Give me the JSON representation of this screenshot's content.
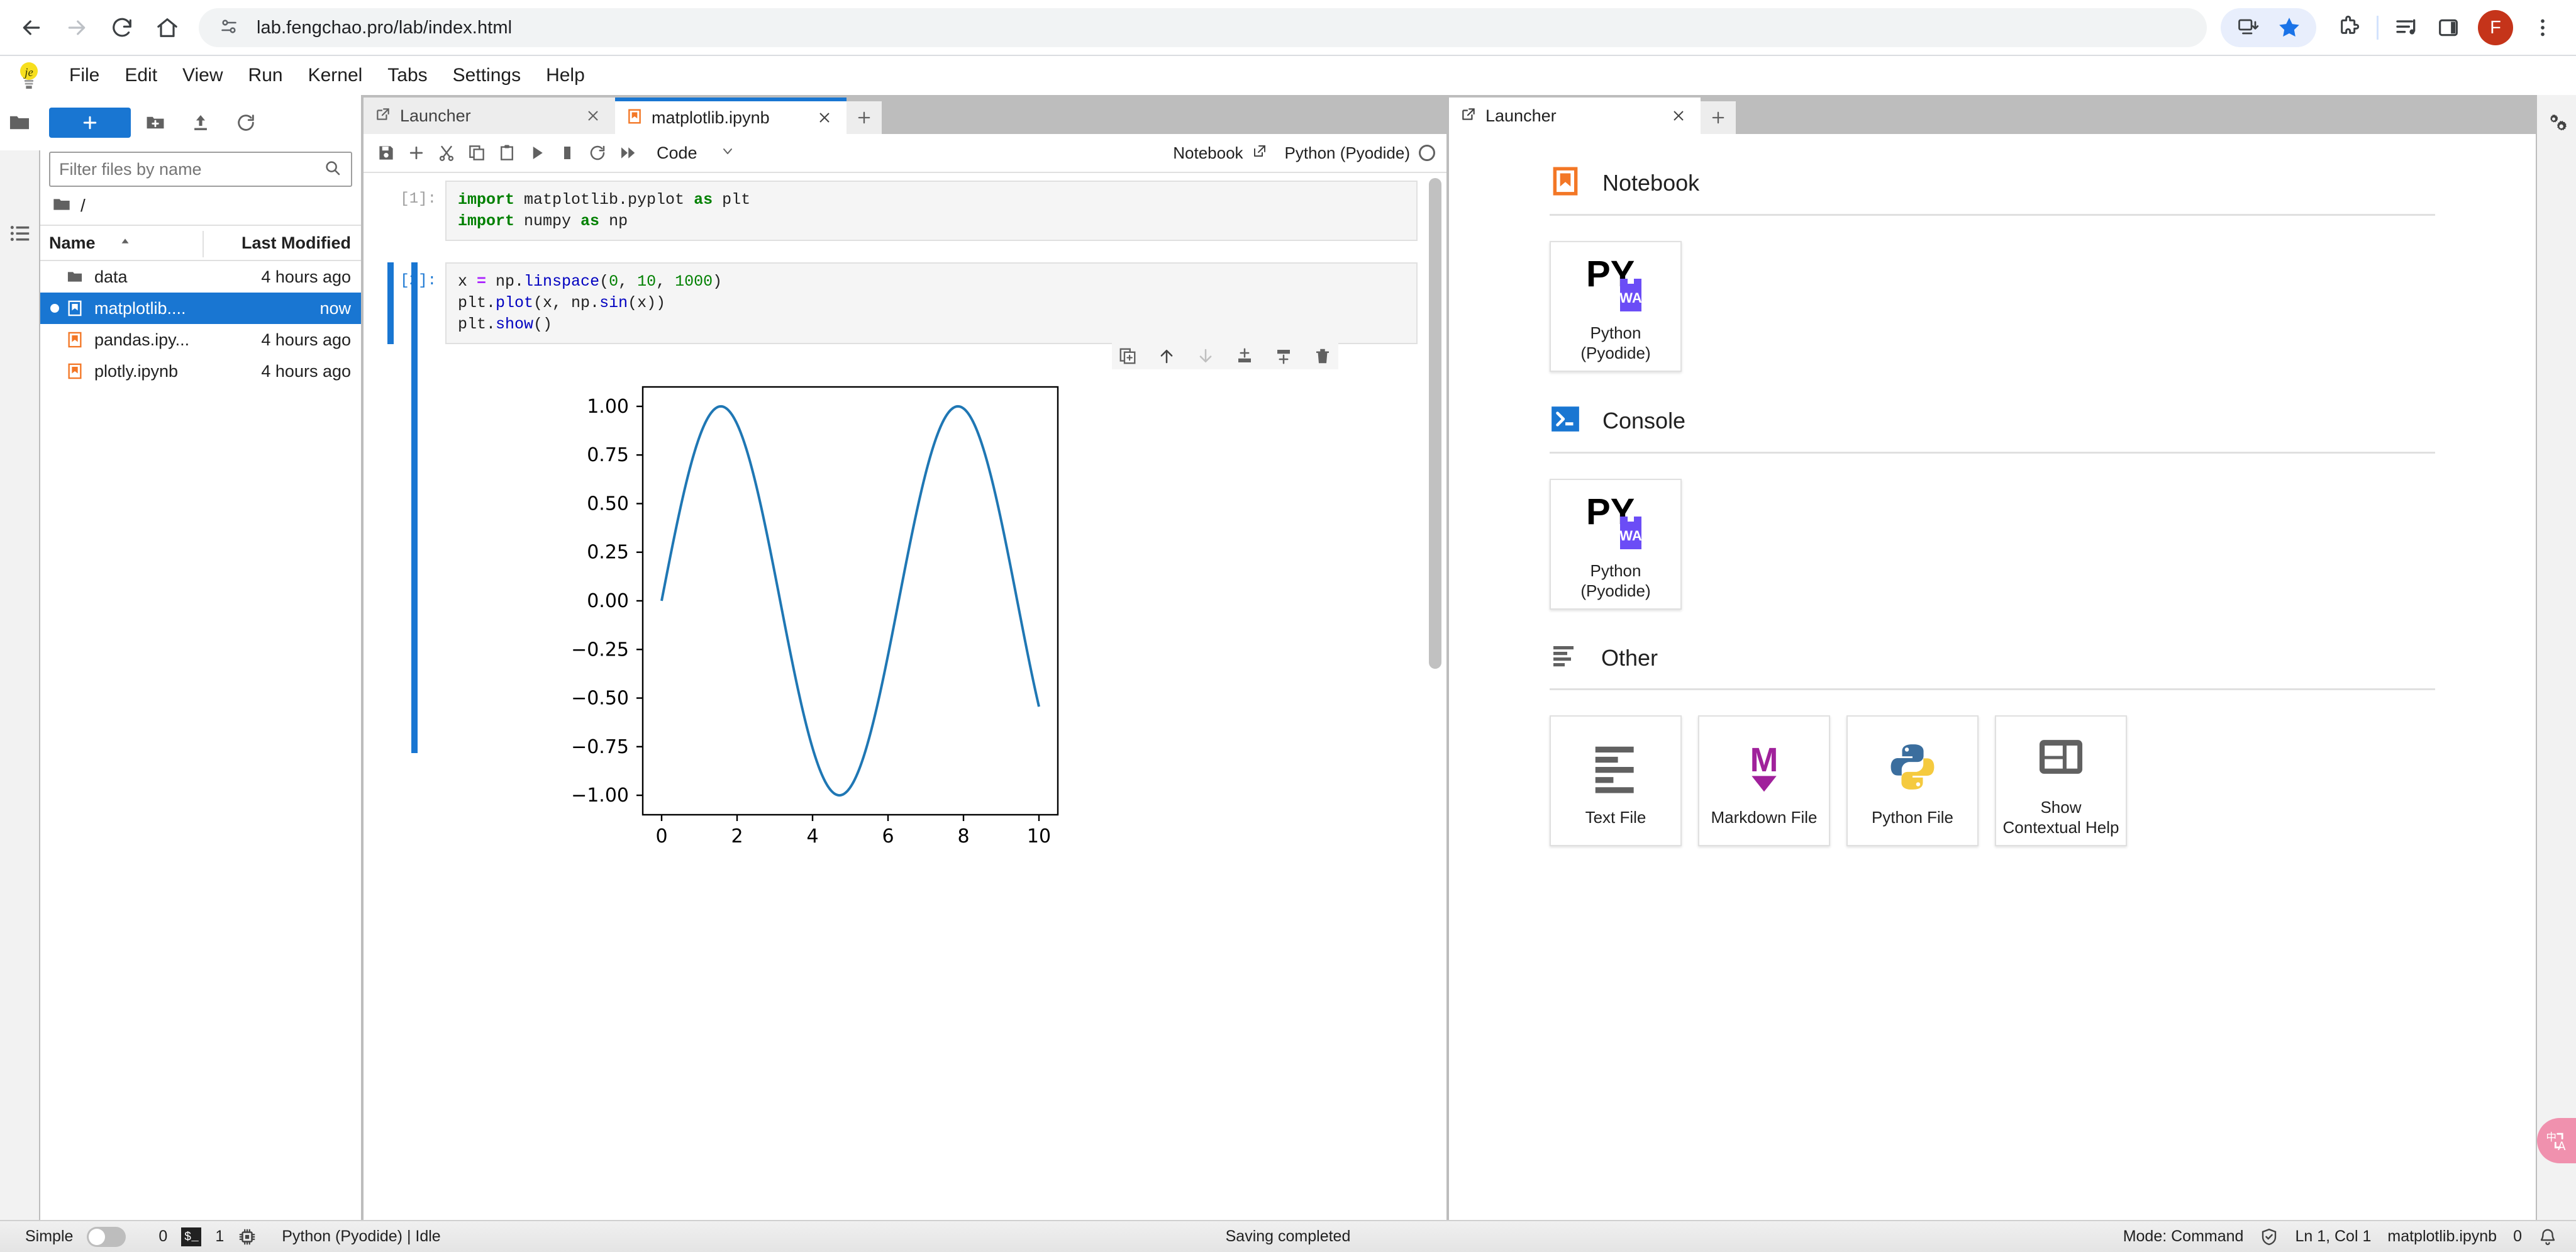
{
  "browser": {
    "url": "lab.fengchao.pro/lab/index.html",
    "back_icon": "back-arrow-icon",
    "forward_icon": "forward-arrow-icon",
    "reload_icon": "reload-icon",
    "home_icon": "home-icon",
    "site_settings_icon": "site-settings-icon",
    "install_icon": "install-app-icon",
    "bookmark_icon": "star-icon",
    "extensions_icon": "puzzle-icon",
    "media_icon": "media-list-icon",
    "side_panel_icon": "side-panel-icon",
    "avatar_letter": "F",
    "menu_icon": "kebab-menu-icon"
  },
  "menubar": {
    "logo": "jupyter-logo",
    "items": [
      "File",
      "Edit",
      "View",
      "Run",
      "Kernel",
      "Tabs",
      "Settings",
      "Help"
    ]
  },
  "activity_bar": {
    "items": [
      {
        "name": "file-browser",
        "icon": "folder-icon",
        "active": true
      },
      {
        "name": "running-sessions",
        "icon": "stop-circle-icon",
        "active": false
      },
      {
        "name": "commands",
        "icon": "list-icon",
        "active": false
      }
    ]
  },
  "file_browser": {
    "new_launcher_label": "+",
    "new_folder_icon": "new-folder-icon",
    "upload_icon": "upload-icon",
    "refresh_icon": "refresh-icon",
    "filter_placeholder": "Filter files by name",
    "search_icon": "search-icon",
    "breadcrumb": "/",
    "columns": [
      "Name",
      "Last Modified"
    ],
    "sort_icon": "sort-ascending-icon",
    "files": [
      {
        "name": "data",
        "modified": "4 hours ago",
        "type": "folder",
        "selected": false,
        "unsaved": false
      },
      {
        "name": "matplotlib....",
        "modified": "now",
        "type": "notebook",
        "selected": true,
        "unsaved": true
      },
      {
        "name": "pandas.ipy...",
        "modified": "4 hours ago",
        "type": "notebook",
        "selected": false,
        "unsaved": false
      },
      {
        "name": "plotly.ipynb",
        "modified": "4 hours ago",
        "type": "notebook",
        "selected": false,
        "unsaved": false
      }
    ]
  },
  "notebook_dock": {
    "tabs": [
      {
        "label": "Launcher",
        "icon": "launcher-icon",
        "active": false
      },
      {
        "label": "matplotlib.ipynb",
        "icon": "notebook-icon",
        "active": true
      }
    ],
    "add_tab_icon": "plus-icon",
    "toolbar": {
      "save_icon": "save-icon",
      "insert_icon": "insert-cell-icon",
      "cut_icon": "cut-icon",
      "copy_icon": "copy-icon",
      "paste_icon": "paste-icon",
      "run_icon": "run-icon",
      "stop_icon": "stop-icon",
      "restart_icon": "restart-icon",
      "restart_run_all_icon": "restart-run-all-icon",
      "cell_type": "Code",
      "cell_type_chevron": "chevron-down-icon",
      "notebook_label": "Notebook",
      "external_link_icon": "external-link-icon",
      "kernel_label": "Python (Pyodide)",
      "kernel_status_icon": "kernel-idle-circle"
    },
    "cells": [
      {
        "prompt": "[1]:",
        "active": false,
        "lines": [
          [
            {
              "t": "import",
              "c": "kw"
            },
            {
              "t": " matplotlib.pyplot ",
              "c": ""
            },
            {
              "t": "as",
              "c": "kw"
            },
            {
              "t": " plt",
              "c": ""
            }
          ],
          [
            {
              "t": "import",
              "c": "kw"
            },
            {
              "t": " numpy ",
              "c": ""
            },
            {
              "t": "as",
              "c": "kw"
            },
            {
              "t": " np",
              "c": ""
            }
          ]
        ]
      },
      {
        "prompt": "[2]:",
        "active": true,
        "lines": [
          [
            {
              "t": "x ",
              "c": ""
            },
            {
              "t": "=",
              "c": "op"
            },
            {
              "t": " np.",
              "c": ""
            },
            {
              "t": "linspace",
              "c": "fn"
            },
            {
              "t": "(",
              "c": ""
            },
            {
              "t": "0",
              "c": "num"
            },
            {
              "t": ", ",
              "c": ""
            },
            {
              "t": "10",
              "c": "num"
            },
            {
              "t": ", ",
              "c": ""
            },
            {
              "t": "1000",
              "c": "num"
            },
            {
              "t": ")",
              "c": ""
            }
          ],
          [
            {
              "t": "plt.",
              "c": ""
            },
            {
              "t": "plot",
              "c": "fn"
            },
            {
              "t": "(x, np.",
              "c": ""
            },
            {
              "t": "sin",
              "c": "fn"
            },
            {
              "t": "(x))",
              "c": ""
            }
          ],
          [
            {
              "t": "plt.",
              "c": ""
            },
            {
              "t": "show",
              "c": "fn"
            },
            {
              "t": "()",
              "c": ""
            }
          ]
        ]
      }
    ],
    "cell_toolbar_icons": [
      "duplicate-cell-icon",
      "move-cell-up-icon",
      "move-cell-down-icon",
      "insert-cell-above-icon",
      "insert-cell-below-icon",
      "delete-cell-icon"
    ]
  },
  "chart_data": {
    "type": "line",
    "title": "",
    "xlabel": "",
    "ylabel": "",
    "xlim": [
      -0.5,
      10.5
    ],
    "ylim": [
      -1.1,
      1.1
    ],
    "xticks": [
      0,
      2,
      4,
      6,
      8,
      10
    ],
    "yticks": [
      -1.0,
      -0.75,
      -0.5,
      -0.25,
      0.0,
      0.25,
      0.5,
      0.75,
      1.0
    ],
    "xtick_labels": [
      "0",
      "2",
      "4",
      "6",
      "8",
      "10"
    ],
    "ytick_labels": [
      "-1.00",
      "-0.75",
      "-0.50",
      "-0.25",
      "0.00",
      "0.25",
      "0.50",
      "0.75",
      "1.00"
    ],
    "grid": false,
    "legend": null,
    "line_color": "#1f77b4",
    "series": [
      {
        "name": "sin(x)",
        "expression": "np.sin(x)",
        "x_start": 0,
        "x_end": 10,
        "n_points": 1000
      }
    ]
  },
  "launcher_dock": {
    "tabs": [
      {
        "label": "Launcher",
        "icon": "launcher-icon",
        "active": true
      }
    ],
    "close_icon": "close-icon",
    "add_tab_icon": "plus-icon",
    "sections": [
      {
        "title": "Notebook",
        "icon": "notebook-section-icon",
        "cards": [
          {
            "label": "Python\n(Pyodide)",
            "icon": "pyodide-icon"
          }
        ]
      },
      {
        "title": "Console",
        "icon": "console-section-icon",
        "cards": [
          {
            "label": "Python\n(Pyodide)",
            "icon": "pyodide-icon"
          }
        ]
      },
      {
        "title": "Other",
        "icon": "other-section-icon",
        "cards": [
          {
            "label": "Text File",
            "icon": "text-file-icon"
          },
          {
            "label": "Markdown File",
            "icon": "markdown-file-icon"
          },
          {
            "label": "Python File",
            "icon": "python-file-icon"
          },
          {
            "label": "Show\nContextual Help",
            "icon": "contextual-help-icon"
          }
        ]
      }
    ]
  },
  "right_bar": {
    "items": [
      {
        "name": "property-inspector",
        "icon": "gears-icon"
      }
    ],
    "ime_badge": {
      "icon": "ime-translate-icon",
      "glyphs": "中A"
    }
  },
  "status_bar": {
    "simple_label": "Simple",
    "simple_toggle_on": false,
    "terminal_count": "0",
    "terminal_icon": "terminal-icon",
    "kernel_count": "1",
    "kernel_icon": "cpu-icon",
    "kernel_status": "Python (Pyodide) | Idle",
    "center_message": "Saving completed",
    "mode": "Mode: Command",
    "trust_icon": "shield-check-icon",
    "cursor_position": "Ln 1, Col 1",
    "file_name": "matplotlib.ipynb",
    "notification_count": "0",
    "bell_icon": "bell-icon"
  },
  "colors": {
    "accent": "#1976d2",
    "jupyter_orange": "#f37726",
    "plot_blue": "#1f77b4",
    "ime_pink": "#f091ae"
  }
}
